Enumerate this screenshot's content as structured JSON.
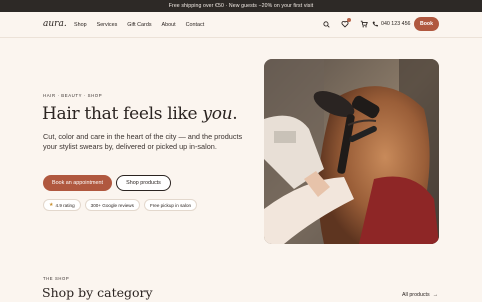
{
  "announcement": "Free shipping over €50 · New guests −20% on your first visit",
  "brand": "aura.",
  "nav": {
    "links": [
      "Shop",
      "Services",
      "Gift Cards",
      "About",
      "Contact"
    ],
    "phone": "040 123 456",
    "book_label": "Book",
    "icons": [
      "search-icon",
      "heart-icon",
      "cart-icon",
      "phone-icon"
    ]
  },
  "hero": {
    "eyebrow": "HAIR · BEAUTY · SHOP",
    "headline_prefix": "Hair that feels like ",
    "headline_emph": "you",
    "headline_suffix": ".",
    "description": "Cut, color and care in the heart of the city — and the products your stylist swears by, delivered or picked up in-salon.",
    "primary_cta": "Book an appointment",
    "secondary_cta": "Shop products",
    "chips": [
      "4.9 rating",
      "300+ Google reviews",
      "Free pickup in salon"
    ]
  },
  "shop_section": {
    "eyebrow": "THE SHOP",
    "title": "Shop by category",
    "all_link": "All products"
  },
  "colors": {
    "accent": "#b0583f",
    "background": "#fbf5ef",
    "announcement_bg": "#2d2926"
  }
}
